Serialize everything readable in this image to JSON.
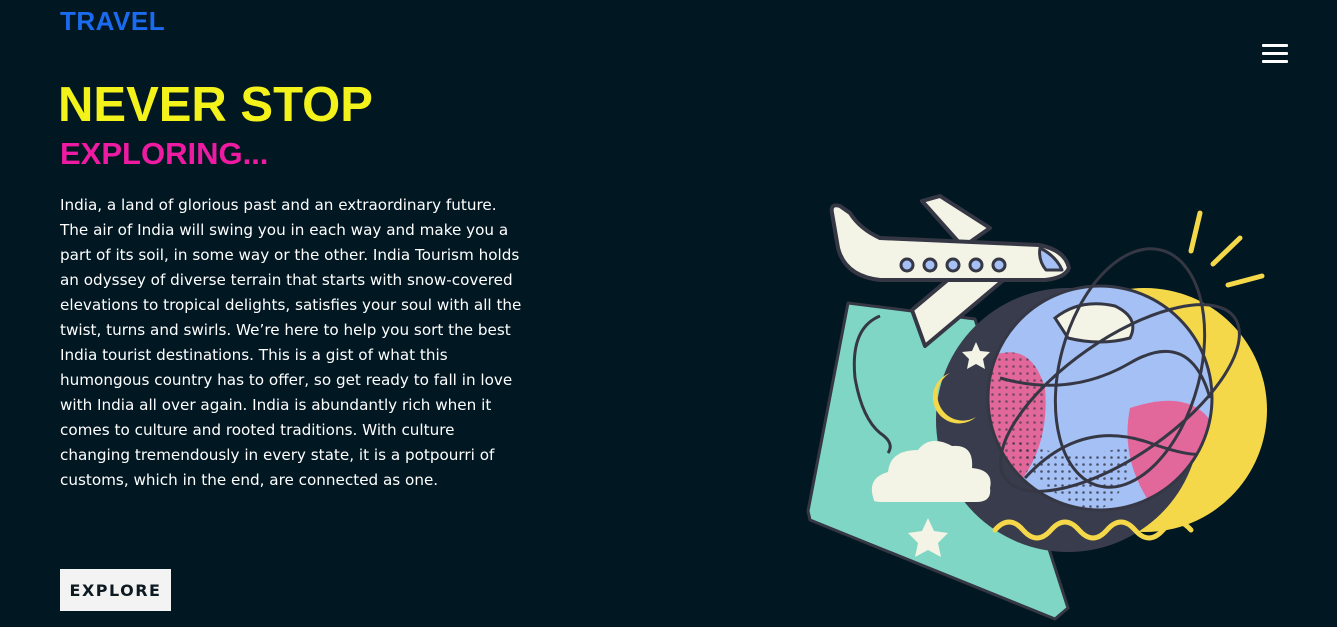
{
  "header": {
    "logo": "TRAVEL",
    "menu_icon": "hamburger-menu-icon"
  },
  "hero": {
    "title": "NEVER STOP",
    "subtitle": "EXPLORING...",
    "description": "India, a land of glorious past and an extraordinary future. The air of India will swing you in each way and make you a part of its soil, in some way or the other. India Tourism holds an odyssey of diverse terrain that starts with snow-covered elevations to tropical delights, satisfies your soul with all the twist, turns and swirls. We’re here to help you sort the best India tourist destinations. This is a gist of what this humongous country has to offer, so get ready to fall in love with India all over again. India is abundantly rich when it comes to culture and rooted traditions. With culture changing tremendously in every state, it is a potpourri of customs, which in the end, are connected as one.",
    "cta_label": "EXPLORE"
  },
  "illustration": {
    "icon": "airplane-globe-illustration",
    "colors": {
      "background": "#011722",
      "sun": "#f4d84a",
      "teal": "#7fd6c5",
      "globe_dark": "#393c4c",
      "globe_blue": "#a5c0f5",
      "globe_pink": "#e2679b",
      "cream": "#f3f3e6",
      "outline": "#353744"
    }
  },
  "colors": {
    "logo": "#1a6bf0",
    "title": "#f3f21a",
    "subtitle": "#ef1aa2",
    "text": "#ffffff",
    "button_bg": "#f3f3f3"
  }
}
